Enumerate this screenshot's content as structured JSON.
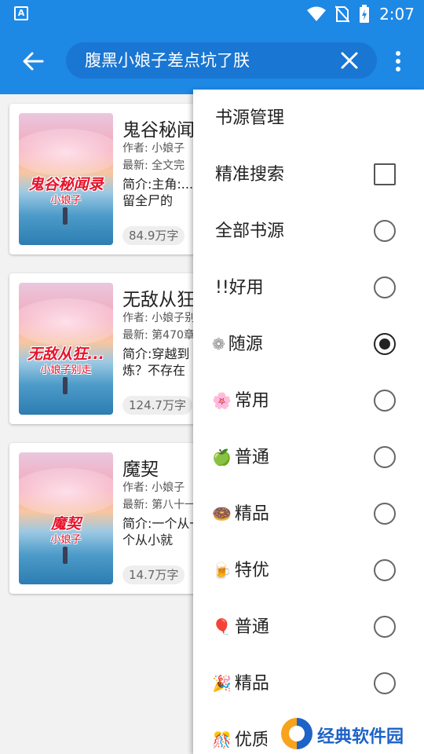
{
  "status_bar": {
    "time": "2:07",
    "colors": {
      "bar": "#1e88e5"
    }
  },
  "app_bar": {
    "search_query": "腹黑小娘子差点坑了朕",
    "back_icon": "arrow-left-icon",
    "clear_icon": "close-icon",
    "more_icon": "more-vert-icon"
  },
  "results": [
    {
      "title": "鬼谷秘闻",
      "author": "作者: 小娘子",
      "latest": "最新: 全文完",
      "intro": "简介:主角:...后留全尸的",
      "words": "84.9万字",
      "cover_title": "鬼谷秘闻录",
      "cover_author": "小娘子"
    },
    {
      "title": "无敌从狂",
      "author": "作者: 小娘子别",
      "latest": "最新: 第470章",
      "intro": "简介:穿越到炼？不存在",
      "words": "124.7万字",
      "cover_title": "无敌从狂...",
      "cover_author": "小娘子别走"
    },
    {
      "title": "魔契",
      "author": "作者: 小娘子",
      "latest": "最新: 第八十一",
      "intro": "简介:一个从一个从小就",
      "words": "14.7万字",
      "cover_title": "魔契",
      "cover_author": "小娘子"
    }
  ],
  "menu": {
    "items": [
      {
        "label": "书源管理",
        "emoji": "",
        "control": "none"
      },
      {
        "label": "精准搜索",
        "emoji": "",
        "control": "checkbox",
        "checked": false
      },
      {
        "label": "全部书源",
        "emoji": "",
        "control": "radio",
        "checked": false
      },
      {
        "label": "!!好用",
        "emoji": "",
        "control": "radio",
        "checked": false
      },
      {
        "label": "随源",
        "emoji": "❁",
        "control": "radio",
        "checked": true
      },
      {
        "label": "常用",
        "emoji": "🌸",
        "control": "radio",
        "checked": false
      },
      {
        "label": "普通",
        "emoji": "🍏",
        "control": "radio",
        "checked": false
      },
      {
        "label": "精品",
        "emoji": "🍩",
        "control": "radio",
        "checked": false
      },
      {
        "label": "特优",
        "emoji": "🍺",
        "control": "radio",
        "checked": false
      },
      {
        "label": "普通",
        "emoji": "🎈",
        "control": "radio",
        "checked": false
      },
      {
        "label": "精品",
        "emoji": "🎉",
        "control": "radio",
        "checked": false
      },
      {
        "label": "优质",
        "emoji": "🎊",
        "control": "none"
      }
    ]
  },
  "watermark": {
    "text": "经典软件园"
  }
}
